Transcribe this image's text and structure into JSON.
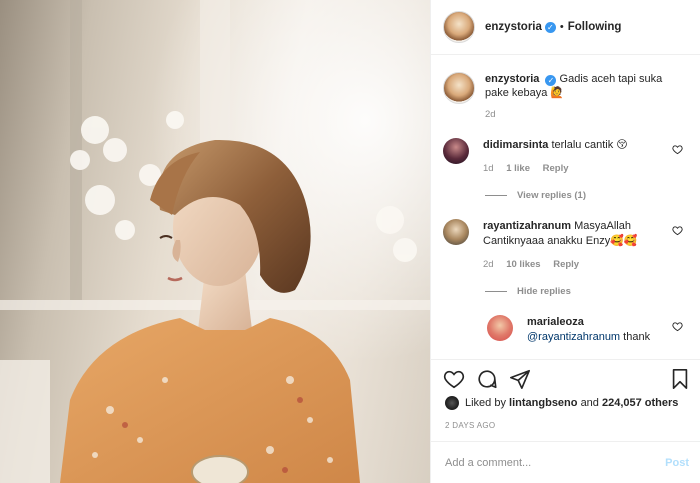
{
  "post": {
    "username": "enzystoria",
    "follow_status": "Following",
    "separator": "•"
  },
  "caption": {
    "username": "enzystoria",
    "text": "Gadis aceh tapi suka pake kebaya 🙋",
    "age": "2d"
  },
  "comments": [
    {
      "username": "didimarsinta",
      "text": "terlalu cantik 😚",
      "age": "1d",
      "likes": "1 like",
      "reply_label": "Reply",
      "replies_toggle": "View replies (1)"
    },
    {
      "username": "rayantizahranum",
      "text": "MasyaAllah Cantiknyaaa anakku Enzy🥰🥰",
      "age": "2d",
      "likes": "10 likes",
      "reply_label": "Reply",
      "replies_toggle": "Hide replies"
    }
  ],
  "reply": {
    "username": "marialeoza",
    "mention": "@rayantizahranum",
    "text": "thank"
  },
  "engagement": {
    "liked_by_prefix": "Liked by",
    "liked_by_user": "lintangbseno",
    "and_label": "and",
    "others_count": "224,057 others",
    "posted_ago": "2 DAYS AGO"
  },
  "composer": {
    "placeholder": "Add a comment...",
    "post_label": "Post"
  },
  "icons": {
    "like": "heart-icon",
    "comment": "comment-icon",
    "share": "share-icon",
    "save": "bookmark-icon",
    "verified": "verified-badge-icon"
  },
  "colors": {
    "verified": "#3897f0",
    "post_disabled": "#b2dffc",
    "secondary_text": "#8e8e8e"
  }
}
